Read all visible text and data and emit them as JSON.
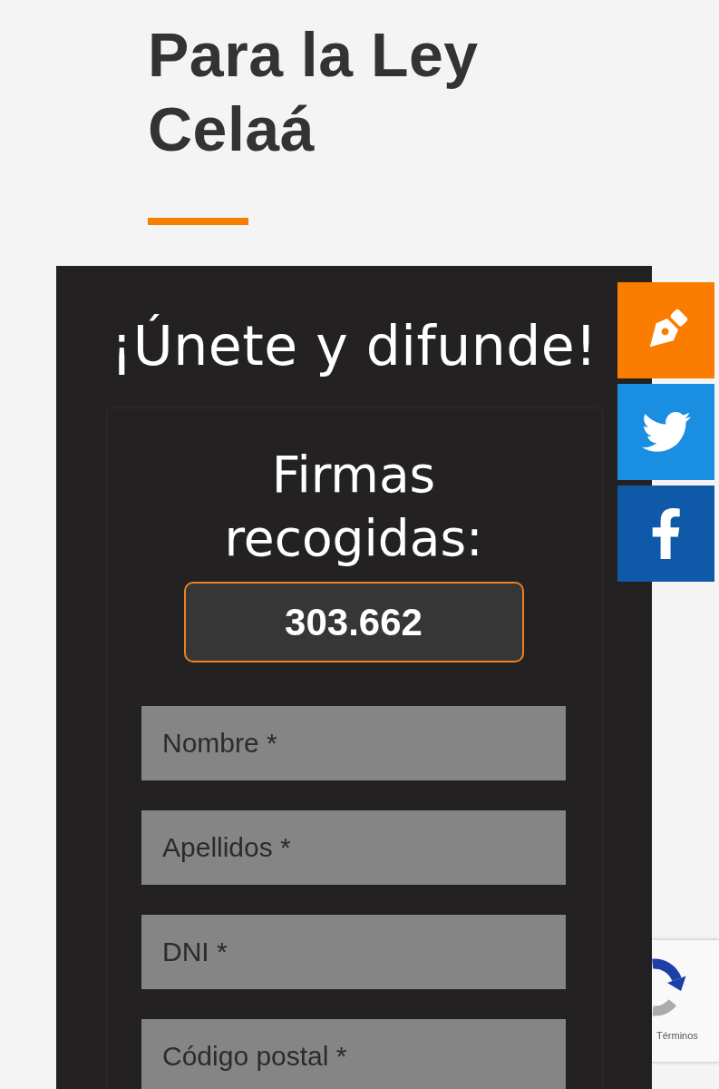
{
  "page": {
    "title": "Para la Ley Celaá"
  },
  "signup": {
    "heading": "¡Únete y difunde!",
    "counter": {
      "label": "Firmas recogidas:",
      "value": "303.662"
    },
    "fields": [
      {
        "placeholder": "Nombre *"
      },
      {
        "placeholder": "Apellidos *"
      },
      {
        "placeholder": "DNI *"
      },
      {
        "placeholder": "Código postal *"
      }
    ]
  },
  "share_bar": [
    {
      "kind": "sign",
      "color": "#fa7d00"
    },
    {
      "kind": "twitter",
      "color": "#1a8ee1"
    },
    {
      "kind": "facebook",
      "color": "#0f5aa8"
    }
  ],
  "recaptcha": {
    "link": "Términos"
  }
}
